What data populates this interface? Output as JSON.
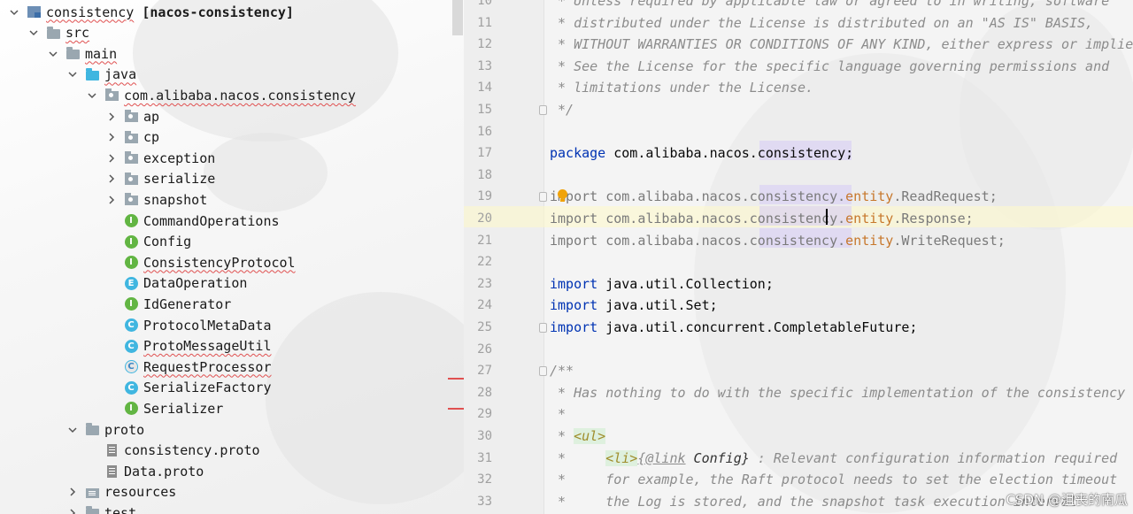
{
  "project_tree": {
    "rows": [
      {
        "label": "consistency",
        "suffix": "[nacos-consistency]",
        "icon": "module-icon",
        "chev": "down"
      },
      {
        "label": "src",
        "icon": "folder-icon",
        "chev": "down"
      },
      {
        "label": "main",
        "icon": "folder-icon",
        "chev": "down"
      },
      {
        "label": "java",
        "icon": "source-folder-icon",
        "chev": "down"
      },
      {
        "label": "com.alibaba.nacos.consistency",
        "icon": "package-icon",
        "chev": "down"
      },
      {
        "label": "ap",
        "icon": "package-icon",
        "chev": "right"
      },
      {
        "label": "cp",
        "icon": "package-icon",
        "chev": "right"
      },
      {
        "label": "exception",
        "icon": "package-icon",
        "chev": "right"
      },
      {
        "label": "serialize",
        "icon": "package-icon",
        "chev": "right"
      },
      {
        "label": "snapshot",
        "icon": "package-icon",
        "chev": "right"
      },
      {
        "label": "CommandOperations",
        "icon": "interface-icon"
      },
      {
        "label": "Config",
        "icon": "interface-icon"
      },
      {
        "label": "ConsistencyProtocol",
        "icon": "interface-icon"
      },
      {
        "label": "DataOperation",
        "icon": "enum-icon"
      },
      {
        "label": "IdGenerator",
        "icon": "interface-icon"
      },
      {
        "label": "ProtocolMetaData",
        "icon": "class-icon"
      },
      {
        "label": "ProtoMessageUtil",
        "icon": "class-icon"
      },
      {
        "label": "RequestProcessor",
        "icon": "abstract-class-icon"
      },
      {
        "label": "SerializeFactory",
        "icon": "class-icon"
      },
      {
        "label": "Serializer",
        "icon": "interface-icon"
      },
      {
        "label": "proto",
        "icon": "folder-icon",
        "chev": "down"
      },
      {
        "label": "consistency.proto",
        "icon": "file-icon"
      },
      {
        "label": "Data.proto",
        "icon": "file-icon"
      },
      {
        "label": "resources",
        "icon": "resources-folder-icon",
        "chev": "right"
      },
      {
        "label": "test",
        "icon": "folder-icon",
        "chev": "right"
      }
    ]
  },
  "editor": {
    "lines": [
      {
        "n": "10",
        "text": " * Unless required by applicable law or agreed to in writing, software"
      },
      {
        "n": "11",
        "text": " * distributed under the License is distributed on an \"AS IS\" BASIS,"
      },
      {
        "n": "12",
        "text": " * WITHOUT WARRANTIES OR CONDITIONS OF ANY KIND, either express or implied."
      },
      {
        "n": "13",
        "text": " * See the License for the specific language governing permissions and"
      },
      {
        "n": "14",
        "text": " * limitations under the License."
      },
      {
        "n": "15",
        "text": " */"
      },
      {
        "n": "16",
        "text": ""
      },
      {
        "n": "17",
        "kw": "package",
        "rest": " com.alibaba.nacos.consistency;"
      },
      {
        "n": "18",
        "text": ""
      },
      {
        "n": "19",
        "imp": "import",
        "pkg": " com.alibaba.nacos.consistency.",
        "ent": "entity",
        "cls": ".ReadRequest;"
      },
      {
        "n": "20",
        "imp": "import",
        "pkg": " com.alibaba.nacos.consistency.",
        "ent": "entity",
        "cls": ".Response;"
      },
      {
        "n": "21",
        "imp": "import",
        "pkg": " com.alibaba.nacos.consistency.",
        "ent": "entity",
        "cls": ".WriteRequest;"
      },
      {
        "n": "22",
        "text": ""
      },
      {
        "n": "23",
        "kw": "import",
        "rest": " java.util.Collection;"
      },
      {
        "n": "24",
        "kw": "import",
        "rest": " java.util.Set;"
      },
      {
        "n": "25",
        "kw": "import",
        "rest": " java.util.concurrent.CompletableFuture;"
      },
      {
        "n": "26",
        "text": ""
      },
      {
        "n": "27",
        "text": "/**"
      },
      {
        "n": "28",
        "text": " * Has nothing to do with the specific implementation of the consistency protocol"
      },
      {
        "n": "29",
        "text": " *"
      },
      {
        "n": "30",
        "pre": " * ",
        "tag": "<ul>"
      },
      {
        "n": "31",
        "pre": " *     ",
        "tag": "<li>",
        "link": "{@link",
        "ref": " Config}",
        "post": " : Relevant configuration information required"
      },
      {
        "n": "32",
        "text": " *     for example, the Raft protocol needs to set the election timeout"
      },
      {
        "n": "33",
        "text": " *     the Log is stored, and the snapshot task execution interval"
      }
    ]
  },
  "watermark": "CSDN @沮丧的南瓜"
}
